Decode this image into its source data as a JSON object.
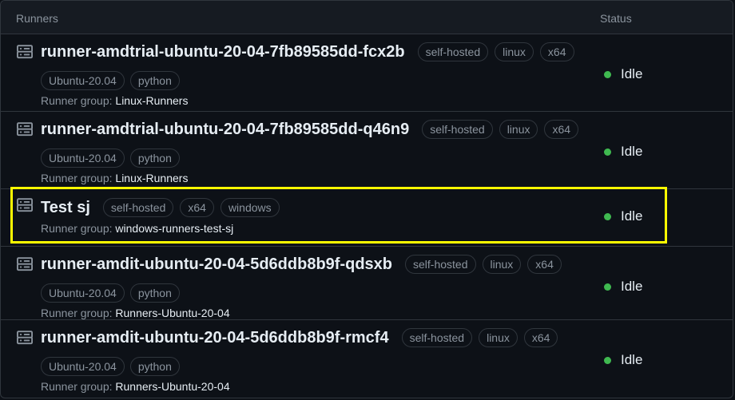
{
  "header": {
    "runners": "Runners",
    "status": "Status"
  },
  "colors": {
    "idle": "#3fb950",
    "highlight": "#ffff00"
  },
  "icons": {
    "runner": "server-icon"
  },
  "runners": [
    {
      "name": "runner-amdtrial-ubuntu-20-04-7fb89585dd-fcx2b",
      "labels": [
        "self-hosted",
        "linux",
        "x64"
      ],
      "extra_labels": [
        "Ubuntu-20.04",
        "python"
      ],
      "group_prefix": "Runner group: ",
      "group": "Linux-Runners",
      "status": "Idle"
    },
    {
      "name": "runner-amdtrial-ubuntu-20-04-7fb89585dd-q46n9",
      "labels": [
        "self-hosted",
        "linux",
        "x64"
      ],
      "extra_labels": [
        "Ubuntu-20.04",
        "python"
      ],
      "group_prefix": "Runner group: ",
      "group": "Linux-Runners",
      "status": "Idle"
    },
    {
      "name": "Test sj",
      "labels": [
        "self-hosted",
        "x64",
        "windows"
      ],
      "extra_labels": [],
      "group_prefix": "Runner group: ",
      "group": "windows-runners-test-sj",
      "status": "Idle"
    },
    {
      "name": "runner-amdit-ubuntu-20-04-5d6ddb8b9f-qdsxb",
      "labels": [
        "self-hosted",
        "linux",
        "x64"
      ],
      "extra_labels": [
        "Ubuntu-20.04",
        "python"
      ],
      "group_prefix": "Runner group: ",
      "group": "Runners-Ubuntu-20-04",
      "status": "Idle"
    },
    {
      "name": "runner-amdit-ubuntu-20-04-5d6ddb8b9f-rmcf4",
      "labels": [
        "self-hosted",
        "linux",
        "x64"
      ],
      "extra_labels": [
        "Ubuntu-20.04",
        "python"
      ],
      "group_prefix": "Runner group: ",
      "group": "Runners-Ubuntu-20-04",
      "status": "Idle"
    }
  ]
}
